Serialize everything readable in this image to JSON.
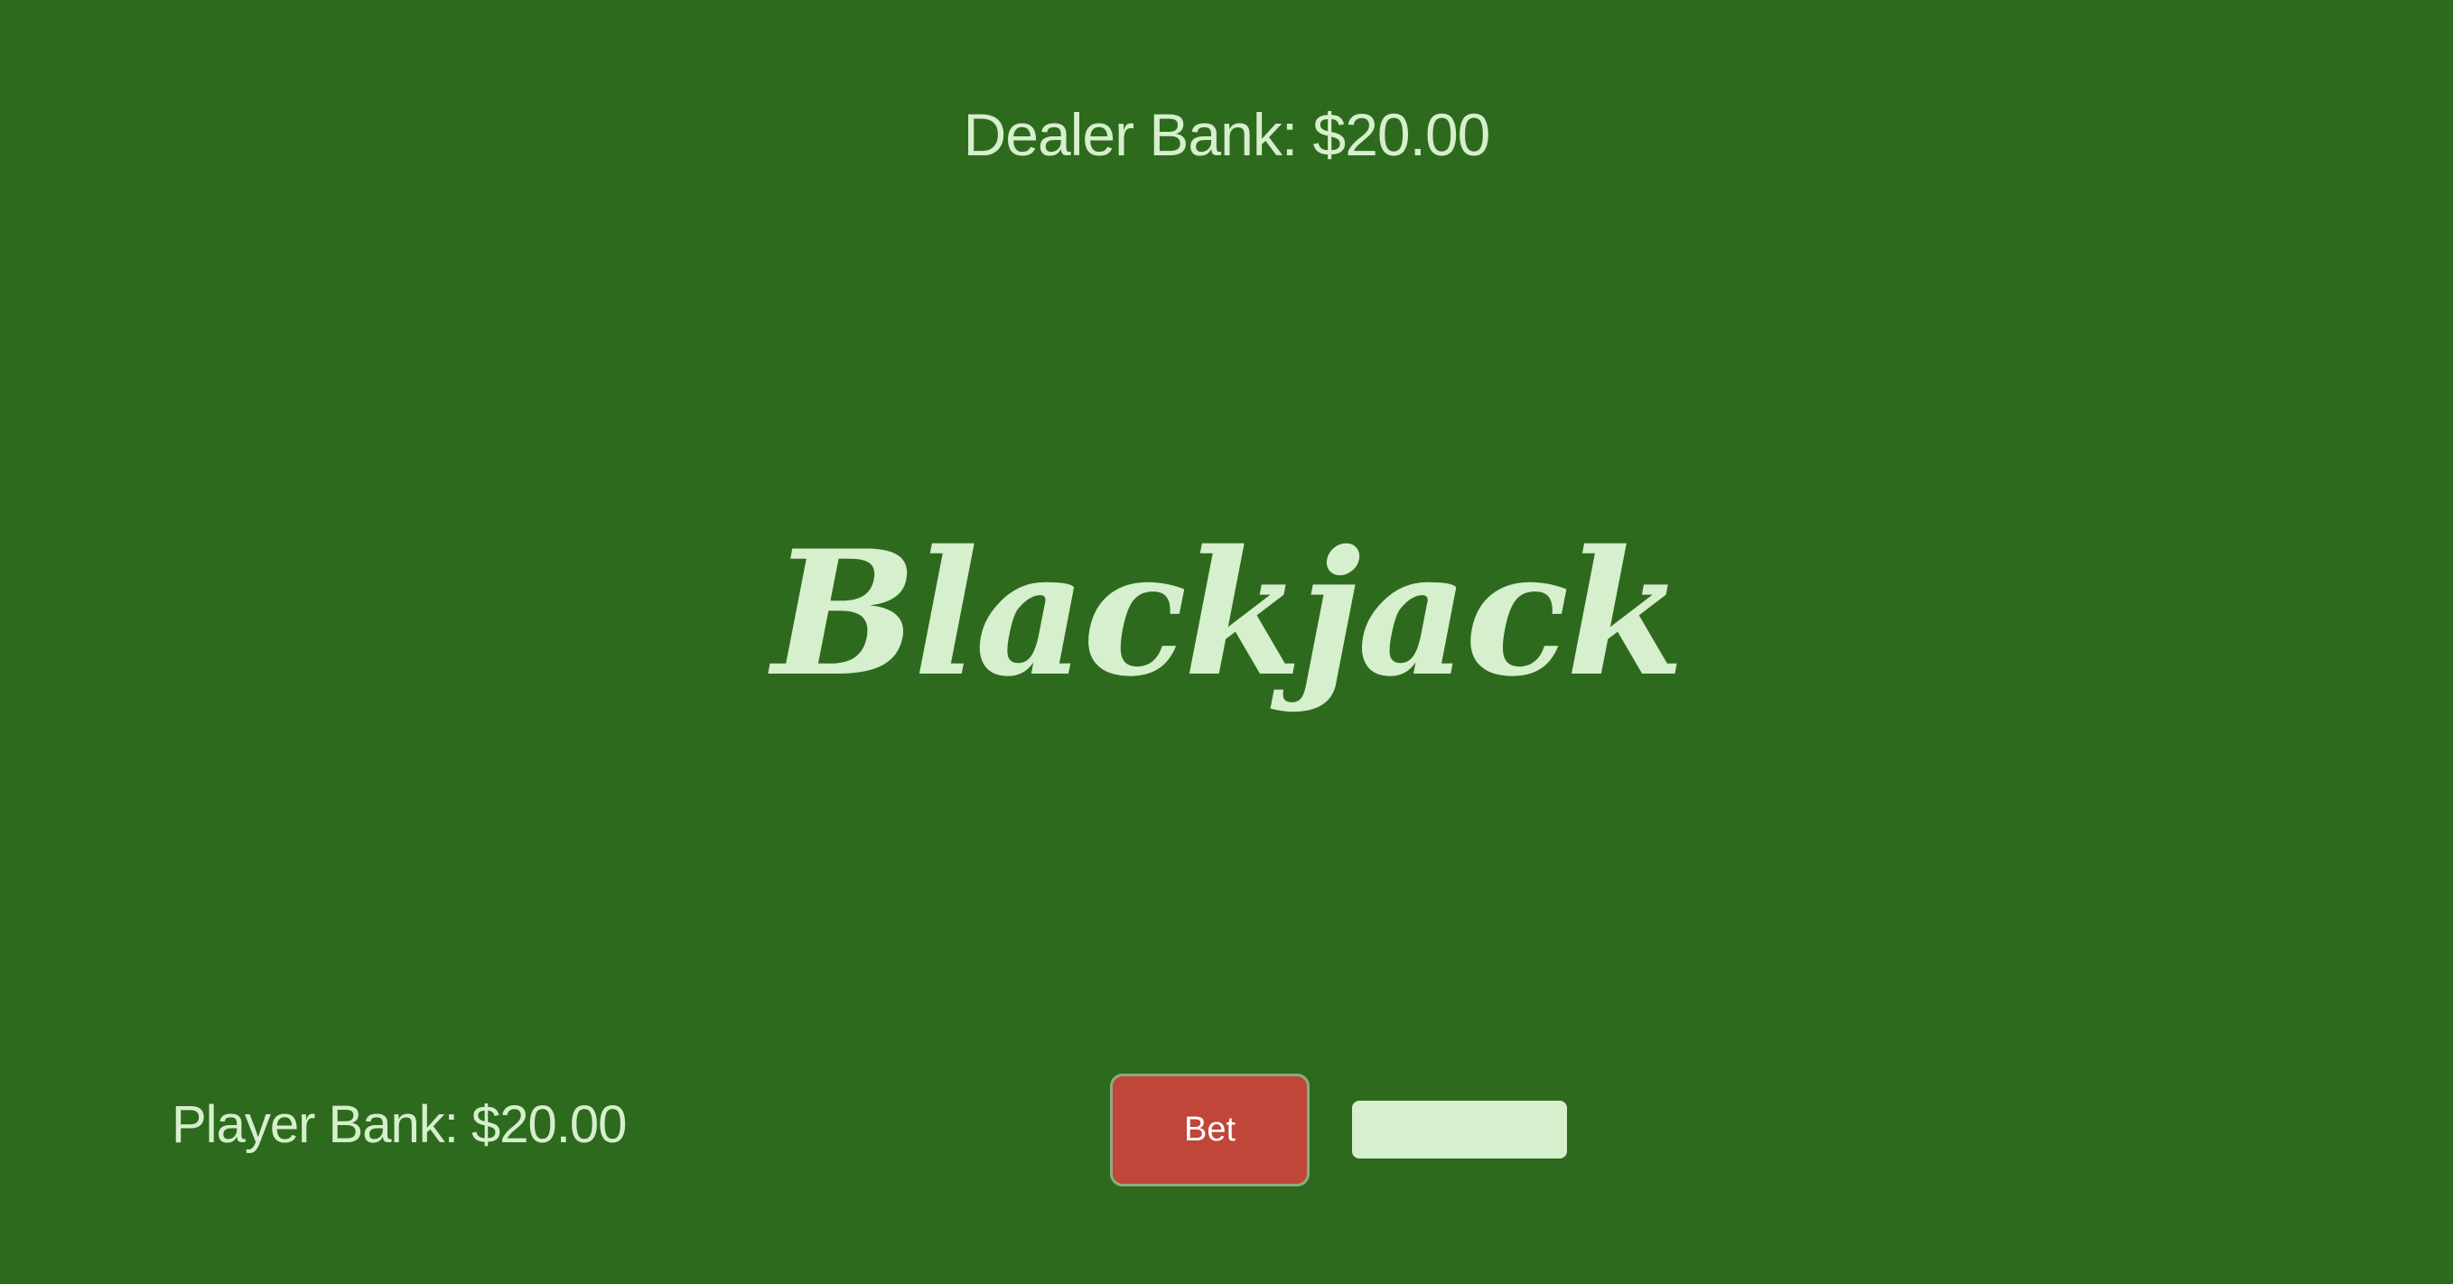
{
  "dealer": {
    "bank_label": "Dealer Bank: $20.00"
  },
  "game": {
    "title": "Blackjack"
  },
  "player": {
    "bank_label": "Player Bank: $20.00"
  },
  "controls": {
    "bet_button_label": "Bet",
    "bet_input_value": "",
    "bet_input_placeholder": ""
  },
  "colors": {
    "table_green": "#2d6a1d",
    "text_light_green": "#d6efcc",
    "bet_button_red": "#c0463a",
    "bet_button_border": "#8dac83",
    "bet_button_text": "#ffffff"
  }
}
